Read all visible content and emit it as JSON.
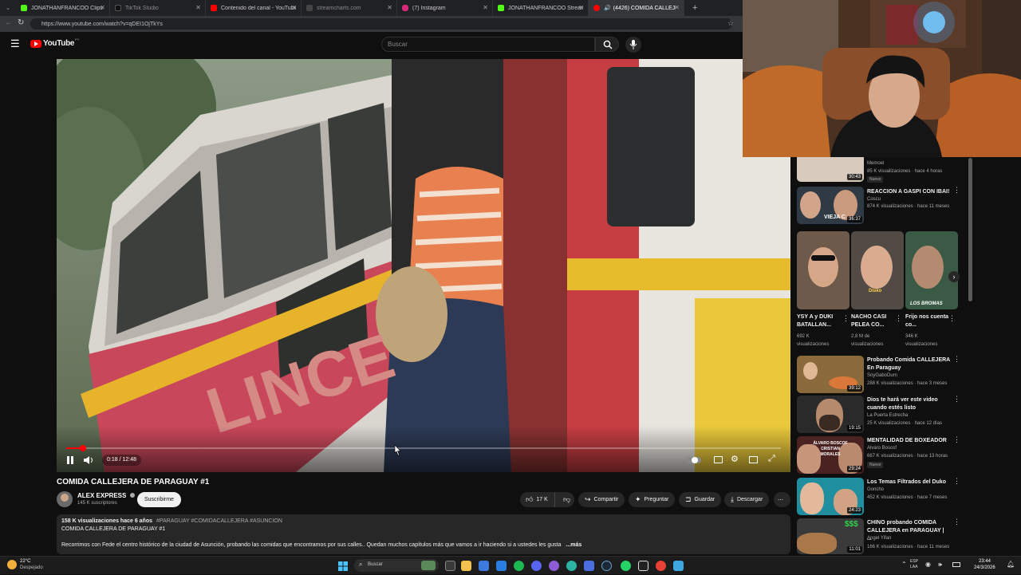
{
  "browser": {
    "tabs": [
      {
        "label": "JONATHANFRANCOO Clips - Watch",
        "color": "#53fc18"
      },
      {
        "label": "TikTok Studio",
        "color": "#111111"
      },
      {
        "label": "Contenido del canal - YouTube Studio",
        "color": "#ff0000"
      },
      {
        "label": "streamcharts.com",
        "color": "#444444"
      },
      {
        "label": "(7) Instagram",
        "color": "#d62976"
      },
      {
        "label": "JONATHANFRANCOO Stream - Watch",
        "color": "#53fc18"
      },
      {
        "label": "(4426) COMIDA CALLEJERA DE",
        "color": "#ff0000"
      }
    ],
    "new_tab": "+",
    "url": "https://www.youtube.com/watch?v=qDEI1OjTkYs"
  },
  "youtube": {
    "logo": "YouTube",
    "country": "PY",
    "search_placeholder": "Buscar"
  },
  "player": {
    "time": "0:18 / 12:48",
    "progress": 0.023,
    "bus_text": "LINCE"
  },
  "video": {
    "title": "COMIDA CALLEJERA DE PARAGUAY #1",
    "channel": "ALEX EXPRESS",
    "subscribers": "145 K suscriptores",
    "subscribe_label": "Suscribirme",
    "likes": "17 K",
    "share_label": "Compartir",
    "ask_label": "Preguntar",
    "save_label": "Guardar",
    "download_label": "Descargar",
    "views_date": "158 K visualizaciones  hace 6 años",
    "hashtags": "#PARAGUAY #COMIDACALLEJERA #ASUNCION",
    "desc_title": "COMIDA CALLEJERA DE PARAGUAY #1",
    "desc_body": "Recorrimos con Fede el centro histórico de la ciudad de Asunción, probando las comidas que encontramos por sus calles.. Quedan muchos capítulos más que vamos a ir haciendo si a ustedes les gusta",
    "more": "...más"
  },
  "sidebar": {
    "partial_top": {
      "channel": "Memoel",
      "meta": "85 K visualizaciones · hace 4 horas",
      "badge": "Nuevo",
      "duration": "30:43"
    },
    "item2": {
      "title": "REACCION A GASPI CON IBAI!",
      "channel": "Coscu",
      "meta": "874 K visualizaciones · hace 11 meses",
      "duration": "36:37",
      "thumb_text": "VIEJA C"
    },
    "shorts": [
      {
        "title": "YSY A y DUKI BATALLAN...",
        "meta": "692 K visualizaciones"
      },
      {
        "title": "NACHO CASI PELEA CO...",
        "meta": "2,8 M de visualizaciones",
        "thumb_text": "Disko"
      },
      {
        "title": "Frijo nos cuenta co...",
        "meta": "346 K visualizaciones",
        "thumb_text": "LOS BROMAS"
      }
    ],
    "items": [
      {
        "title": "Probando Comida CALLEJERA En Paraguay",
        "channel": "SoyGaboDurn",
        "meta": "288 K visualizaciones · hace 3 meses",
        "duration": "39:12",
        "color": "#8a6a3a"
      },
      {
        "title": "Dios te hará ver este video cuando estés listo",
        "channel": "La Puerta Estrecha",
        "meta": "25 K visualizaciones · hace 12 días",
        "duration": "19:15",
        "color": "#2a2a2a"
      },
      {
        "title": "MENTALIDAD DE BOXEADOR",
        "channel": "Alvaro Boscof",
        "meta": "667 K visualizaciones · hace 13 horas",
        "badge": "Nuevo",
        "duration": "29:24",
        "color": "#4a2222",
        "thumb_text": "ÁLVARO BOSCOF CRISTIAN MORALES"
      },
      {
        "title": "Los Temas Filtrados del Duko",
        "channel": "Goncho",
        "meta": "452 K visualizaciones · hace 7 meses",
        "duration": "24:23",
        "color": "#1f8fa0"
      },
      {
        "title": "CHINO probando COMIDA CALLEJERA en PARAGUAY | ...",
        "channel": "Angel Yifan",
        "meta": "166 K visualizaciones · hace 11 meses",
        "duration": "11:01",
        "color": "#3a3a3a",
        "thumb_text": "$$$"
      }
    ]
  },
  "taskbar": {
    "weather_temp": "22°C",
    "weather_desc": "Despejado",
    "search_placeholder": "Buscar",
    "lang": "ESP",
    "lang2": "LAA",
    "time": "23:44",
    "date": "24/3/2026"
  }
}
